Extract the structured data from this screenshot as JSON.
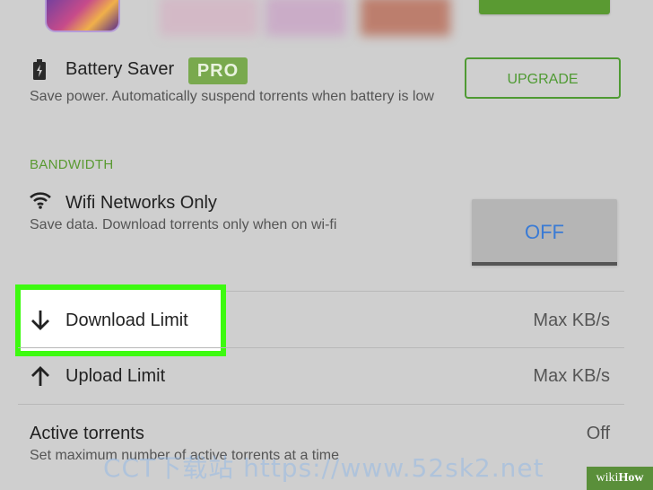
{
  "settings": {
    "battery_saver": {
      "title": "Battery Saver",
      "badge": "PRO",
      "description": "Save power. Automatically suspend torrents when battery is low",
      "upgrade_label": "UPGRADE",
      "icon": "battery-icon"
    },
    "bandwidth_header": "BANDWIDTH",
    "wifi_only": {
      "title": "Wifi Networks Only",
      "description": "Save data. Download torrents only when on wi-fi",
      "toggle_label": "OFF",
      "icon": "wifi-icon"
    },
    "download_limit": {
      "title": "Download Limit",
      "value": "Max KB/s",
      "icon": "arrow-down-icon"
    },
    "upload_limit": {
      "title": "Upload Limit",
      "value": "Max KB/s",
      "icon": "arrow-up-icon"
    },
    "active_torrents": {
      "title": "Active torrents",
      "description": "Set maximum number of active torrents at a time",
      "value": "Off"
    }
  },
  "overlay": {
    "watermark": "CCT下载站 https://www.52sk2.net",
    "brand_prefix": "wiki",
    "brand_suffix": "How"
  },
  "colors": {
    "accent_green": "#5a9a32",
    "highlight_green": "#3dfa10",
    "toggle_text_blue": "#3a7bd5",
    "background": "#cfcfcf"
  }
}
